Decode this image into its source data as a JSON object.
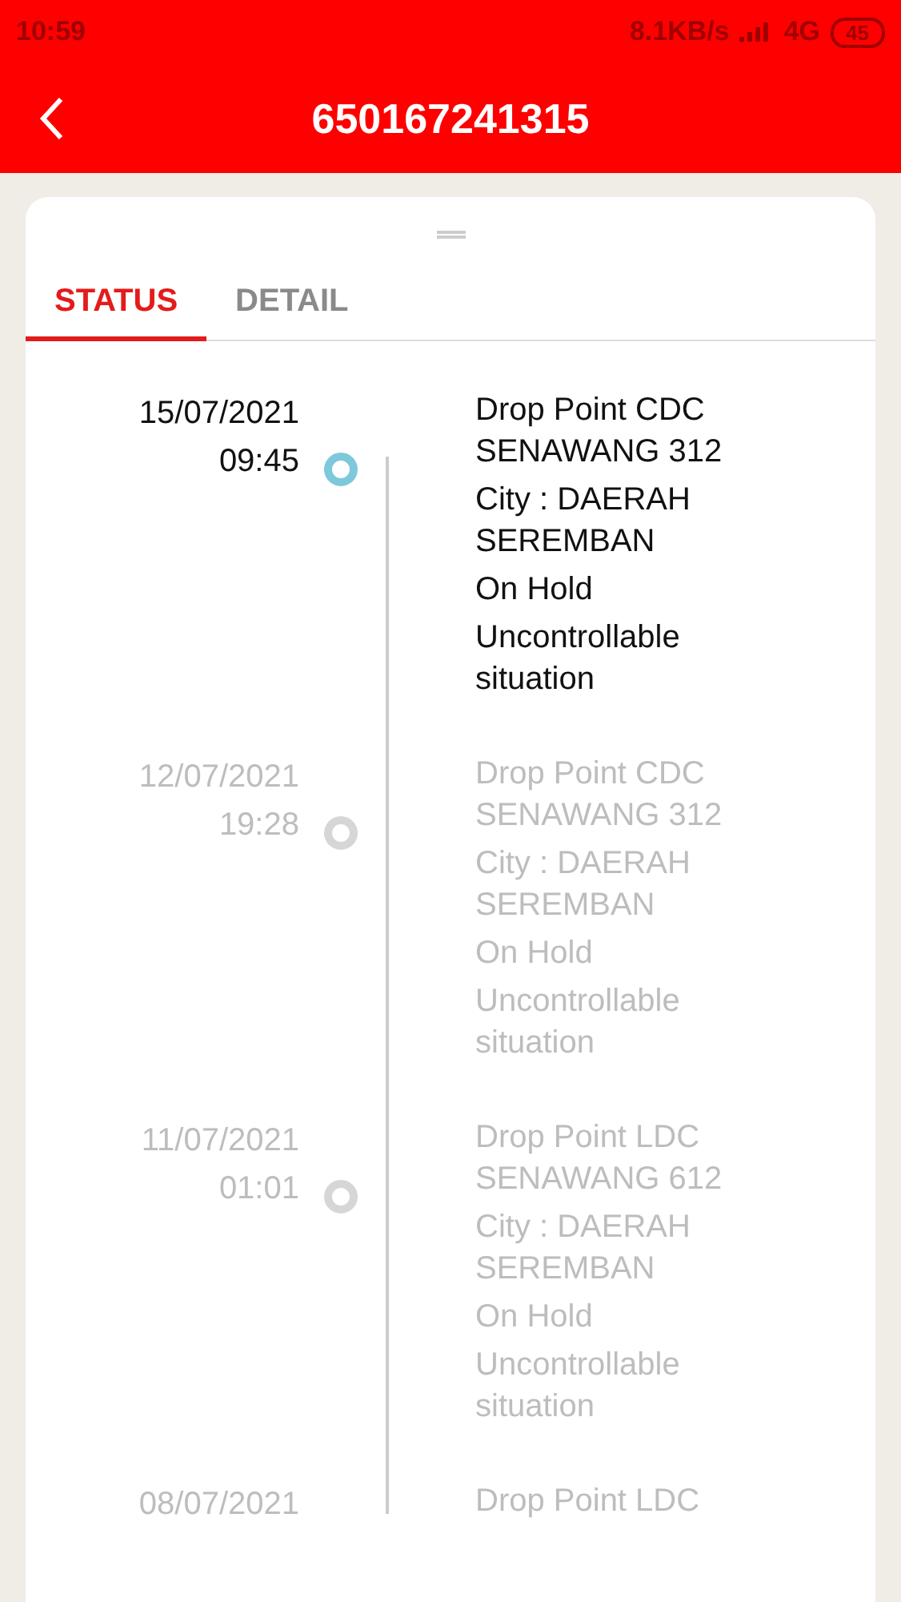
{
  "status_bar": {
    "time": "10:59",
    "speed": "8.1KB/s",
    "network": "4G",
    "battery": "45"
  },
  "header": {
    "title": "650167241315"
  },
  "tabs": [
    {
      "label": "STATUS",
      "selected": true
    },
    {
      "label": "DETAIL",
      "selected": false
    }
  ],
  "timeline": [
    {
      "date": "15/07/2021",
      "time": "09:45",
      "active": true,
      "lines": [
        "Drop Point CDC SENAWANG 312",
        "City : DAERAH SEREMBAN",
        "On Hold",
        "Uncontrollable situation"
      ]
    },
    {
      "date": "12/07/2021",
      "time": "19:28",
      "active": false,
      "lines": [
        "Drop Point CDC SENAWANG 312",
        "City : DAERAH SEREMBAN",
        "On Hold",
        "Uncontrollable situation"
      ]
    },
    {
      "date": "11/07/2021",
      "time": "01:01",
      "active": false,
      "lines": [
        "Drop Point LDC SENAWANG 612",
        "City : DAERAH SEREMBAN",
        "On Hold",
        "Uncontrollable situation"
      ]
    },
    {
      "date": "08/07/2021",
      "active": false,
      "lines": [
        "Drop Point LDC"
      ]
    }
  ]
}
